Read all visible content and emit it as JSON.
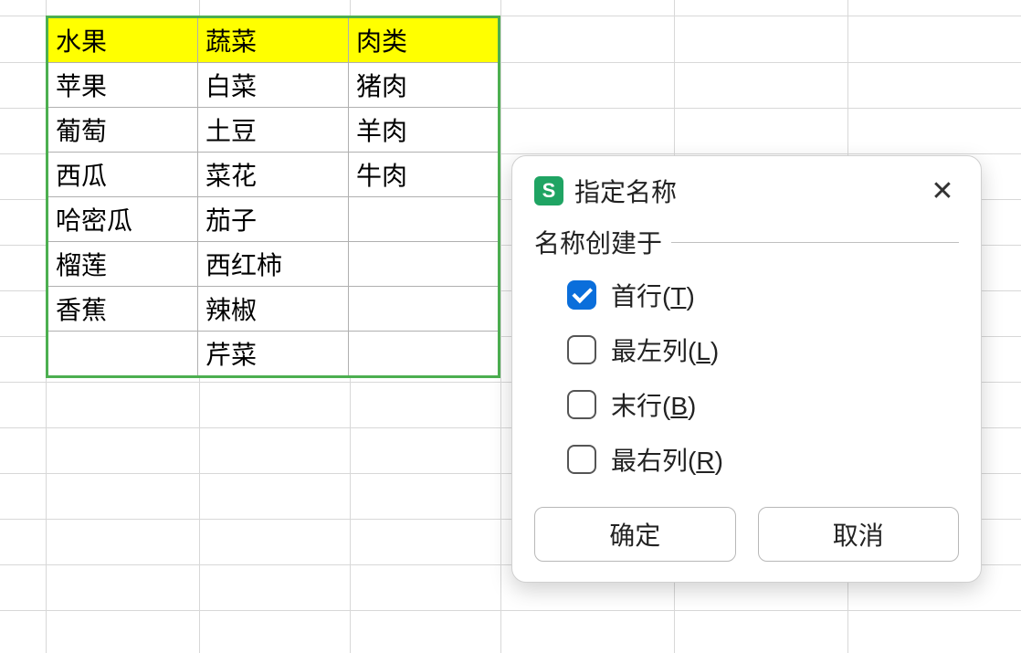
{
  "table": {
    "headers": [
      "水果",
      "蔬菜",
      "肉类"
    ],
    "rows": [
      [
        "苹果",
        "白菜",
        "猪肉"
      ],
      [
        "葡萄",
        "土豆",
        "羊肉"
      ],
      [
        "西瓜",
        "菜花",
        "牛肉"
      ],
      [
        "哈密瓜",
        "茄子",
        ""
      ],
      [
        "榴莲",
        "西红柿",
        ""
      ],
      [
        "香蕉",
        "辣椒",
        ""
      ],
      [
        "",
        "芹菜",
        ""
      ]
    ]
  },
  "dialog": {
    "app_icon_letter": "S",
    "title": "指定名称",
    "close_symbol": "✕",
    "fieldset_label": "名称创建于",
    "options": {
      "top_row": {
        "label": "首行(T)",
        "checked": true
      },
      "left_col": {
        "label": "最左列(L)",
        "checked": false
      },
      "bottom_row": {
        "label": "末行(B)",
        "checked": false
      },
      "right_col": {
        "label": "最右列(R)",
        "checked": false
      }
    },
    "buttons": {
      "ok": "确定",
      "cancel": "取消"
    }
  }
}
